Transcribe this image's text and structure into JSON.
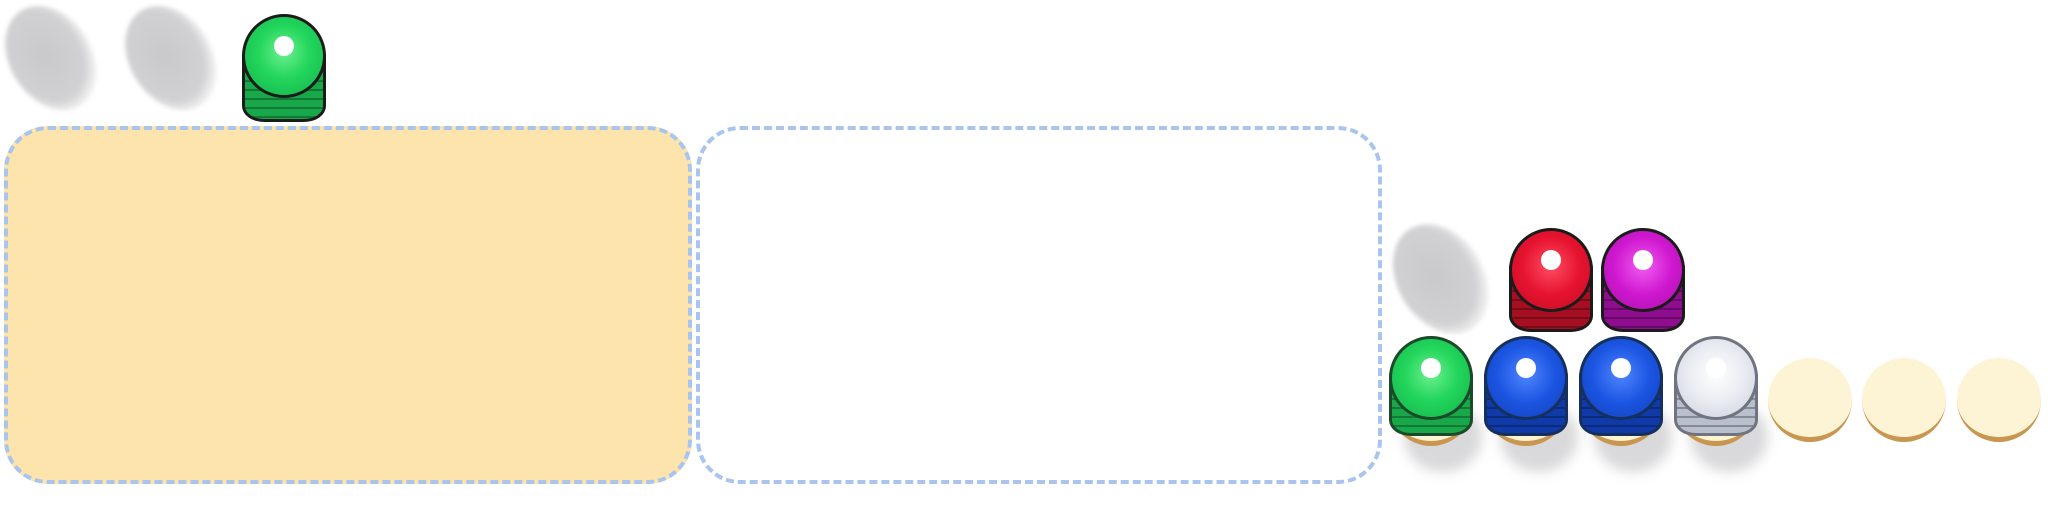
{
  "colors": {
    "green": "#1ed55a",
    "blue": "#1950dc",
    "red": "#e4132e",
    "magenta": "#cc16cc",
    "white": "#e7eaf0",
    "panel_fill": "#fde4ad",
    "panel_border": "#a9c4ef",
    "slot": "#fdf4d6",
    "slot_rim": "#c99650"
  },
  "top_row": {
    "ghosts": 2,
    "spools": [
      "green"
    ]
  },
  "boards": [
    {
      "name": "left-board",
      "state": "filled"
    },
    {
      "name": "right-board",
      "state": "empty"
    }
  ],
  "queue": {
    "ghosts": 1,
    "spools": [
      "red",
      "magenta"
    ]
  },
  "tray": {
    "slots": [
      "green",
      "blue",
      "blue",
      "white",
      "empty",
      "empty",
      "empty"
    ]
  }
}
